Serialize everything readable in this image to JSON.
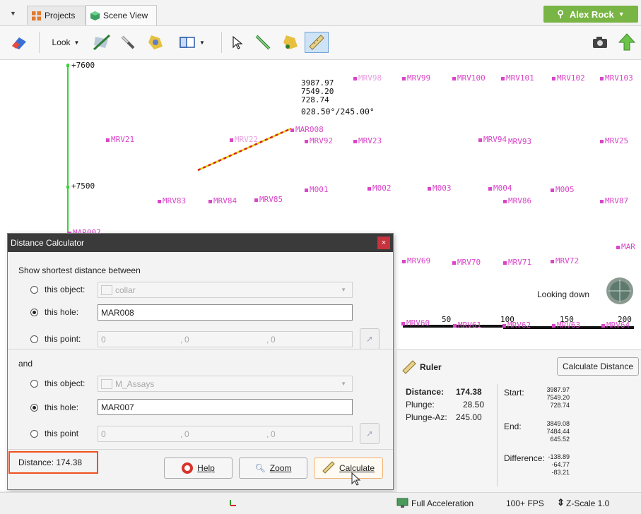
{
  "tabs": {
    "projects_label": "Projects",
    "scene_label": "Scene View"
  },
  "user": {
    "name": "Alex Rock"
  },
  "toolbar": {
    "look_label": "Look"
  },
  "scene": {
    "grid_labels": [
      "+7600",
      "+7500"
    ],
    "marker_labels": {
      "mrv98": "MRV98",
      "mrv99": "MRV99",
      "mrv100": "MRV100",
      "mrv101": "MRV101",
      "mrv102": "MRV102",
      "mrv103": "MRV103",
      "mrv21": "MRV21",
      "mrv22": "MRV22",
      "mar008": "MAR008",
      "mrv92": "MRV92",
      "mrv23": "MRV23",
      "mrv94": "MRV94",
      "mrv93": "MRV93",
      "mrv25": "MRV25",
      "m001": "M001",
      "m002": "M002",
      "m003": "M003",
      "m004": "M004",
      "m005": "M005",
      "mrv83": "MRV83",
      "mrv84": "MRV84",
      "mrv85": "MRV85",
      "mrv86": "MRV86",
      "mrv87": "MRV87",
      "mar007": "MAR007",
      "mar_edge": "MAR",
      "mrv69": "MRV69",
      "mrv70": "MRV70",
      "mrv71": "MRV71",
      "mrv72": "MRV72",
      "mrv60": "MRV60",
      "mrv61": "MRV61",
      "mrv62": "MRV62",
      "mrv63": "MRV63",
      "mrv64": "MRV64"
    },
    "measure_readout": [
      "3987.97",
      "7549.20",
      "728.74"
    ],
    "orientation_readout": "028.50°/245.00°",
    "looking_label": "Looking down",
    "scale_labels": [
      "50",
      "100",
      "150",
      "200"
    ]
  },
  "dialog": {
    "title": "Distance Calculator",
    "close_label": "×",
    "heading": "Show shortest distance between",
    "first": {
      "object_label": "this object:",
      "object_value": "collar",
      "hole_label": "this hole:",
      "hole_value": "MAR008",
      "point_label": "this point:",
      "point_x": "0",
      "point_y": "0",
      "point_z": "0"
    },
    "and_label": "and",
    "second": {
      "object_label": "this object:",
      "object_value": "M_Assays",
      "hole_label": "this hole:",
      "hole_value": "MAR007",
      "point_label": "this point",
      "point_x": "0",
      "point_y": "0",
      "point_z": "0"
    },
    "result": "Distance:  174.38",
    "help_label": "Help",
    "zoom_label": "Zoom",
    "calculate_label": "Calculate"
  },
  "ruler": {
    "title": "Ruler",
    "calc_button": "Calculate Distance",
    "distance_label": "Distance:",
    "distance_value": "174.38",
    "plunge_label": "Plunge:",
    "plunge_value": "28.50",
    "plunge_az_label": "Plunge-Az:",
    "plunge_az_value": "245.00",
    "start_label": "Start:",
    "start_values": [
      "3987.97",
      "7549.20",
      "728.74"
    ],
    "end_label": "End:",
    "end_values": [
      "3849.08",
      "7484.44",
      "645.52"
    ],
    "difference_label": "Difference:",
    "difference_values": [
      "-138.89",
      "-64.77",
      "-83.21"
    ]
  },
  "status": {
    "acceleration": "Full Acceleration",
    "fps": "100+ FPS",
    "zscale": "Z-Scale 1.0"
  },
  "colors": {
    "accent_green": "#78b544",
    "marker_pink": "#d946c8",
    "highlight_orange": "#f0501e",
    "dialog_title_bg": "#3a3a3a"
  }
}
